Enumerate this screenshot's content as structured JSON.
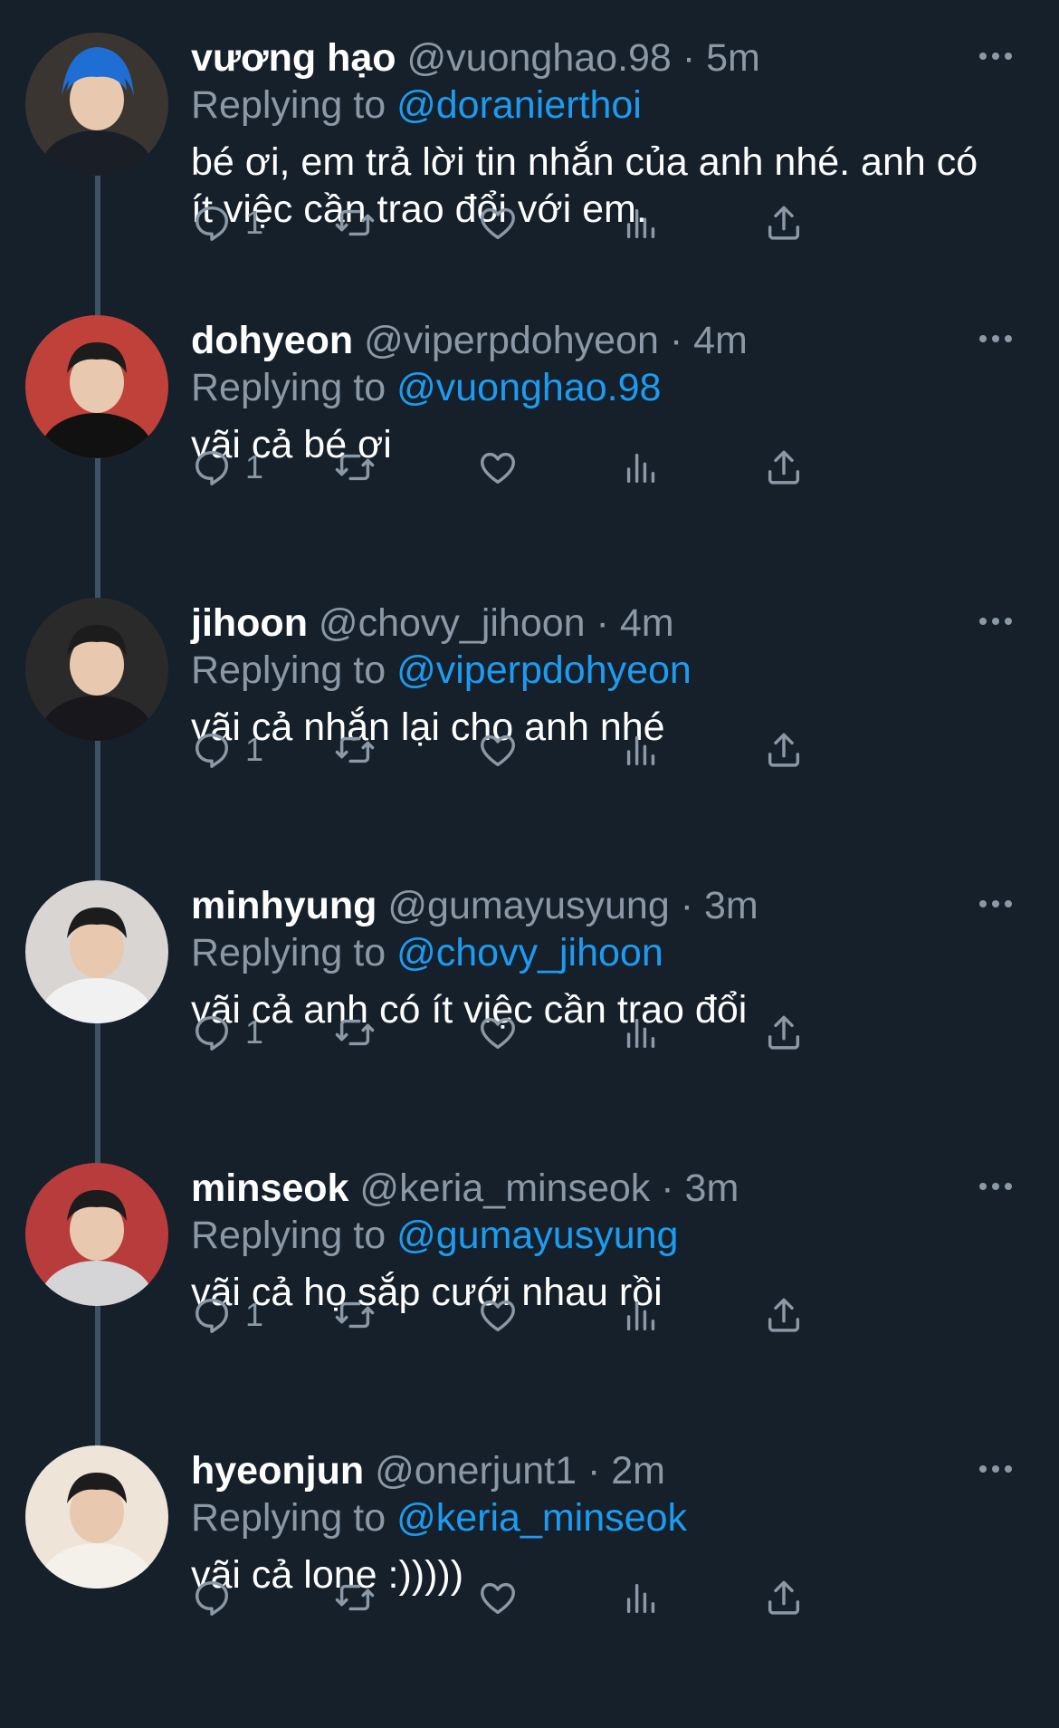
{
  "colors": {
    "background": "#15202b",
    "text": "#ffffff",
    "secondary_text": "#8b98a5",
    "link": "#1d9bf0",
    "thread_line": "#3d5466"
  },
  "icons": {
    "more": "more-horizontal-icon",
    "reply": "reply-bubble-icon",
    "retweet": "retweet-icon",
    "like": "heart-icon",
    "views": "bar-chart-icon",
    "share": "share-upload-icon"
  },
  "reply_prefix": "Replying to",
  "dot": "·",
  "tweets": [
    {
      "name": "vương hạo",
      "handle": "@vuonghao.98",
      "time": "5m",
      "replying_to": "@doranierthoi",
      "text": "bé ơi, em trả lời tin nhắn của anh nhé. anh có ít việc cần trao đổi với em.",
      "reply_count": "1"
    },
    {
      "name": "dohyeon",
      "handle": "@viperpdohyeon",
      "time": "4m",
      "replying_to": "@vuonghao.98",
      "text": "vãi cả bé ơi",
      "reply_count": "1"
    },
    {
      "name": "jihoon",
      "handle": "@chovy_jihoon",
      "time": "4m",
      "replying_to": "@viperpdohyeon",
      "text": "vãi cả nhắn lại cho anh nhé",
      "reply_count": "1"
    },
    {
      "name": "minhyung",
      "handle": "@gumayusyung",
      "time": "3m",
      "replying_to": "@chovy_jihoon",
      "text": "vãi cả anh có ít việc cần trao đổi",
      "reply_count": "1"
    },
    {
      "name": "minseok",
      "handle": "@keria_minseok",
      "time": "3m",
      "replying_to": "@gumayusyung",
      "text": "vãi cả họ sắp cưới nhau rồi",
      "reply_count": "1"
    },
    {
      "name": "hyeonjun",
      "handle": "@onerjunt1",
      "time": "2m",
      "replying_to": "@keria_minseok",
      "text": "vãi cả lone :)))))",
      "reply_count": ""
    }
  ]
}
